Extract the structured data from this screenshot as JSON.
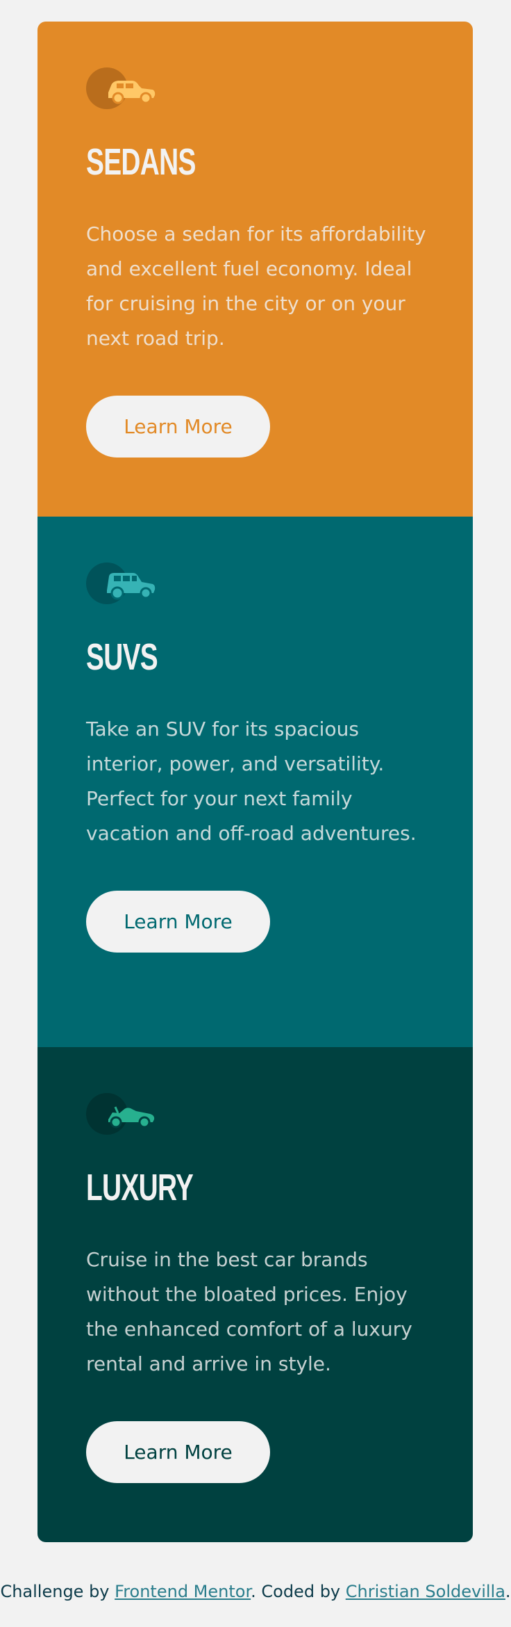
{
  "colors": {
    "page_background": "#f2f2f2",
    "sedans": "#e28a27",
    "suvs": "#006970",
    "luxury": "#004140",
    "button_background": "#f2f2f2"
  },
  "cards": [
    {
      "icon": "sedan-car-icon",
      "title": "Sedans",
      "description": "Choose a sedan for its affordability and excellent fuel economy. Ideal for cruising in the city or on your next road trip.",
      "button_label": "Learn More"
    },
    {
      "icon": "suv-car-icon",
      "title": "SUVs",
      "description": "Take an SUV for its spacious interior, power, and versatility. Perfect for your next family vacation and off-road adventures.",
      "button_label": "Learn More"
    },
    {
      "icon": "luxury-car-icon",
      "title": "Luxury",
      "description": "Cruise in the best car brands without the bloated prices. Enjoy the enhanced comfort of a luxury rental and arrive in style.",
      "button_label": "Learn More"
    }
  ],
  "footer": {
    "prefix": "Challenge by ",
    "link1": "Frontend Mentor",
    "middle": ". Coded by ",
    "link2": "Christian Soldevilla",
    "suffix": "."
  }
}
